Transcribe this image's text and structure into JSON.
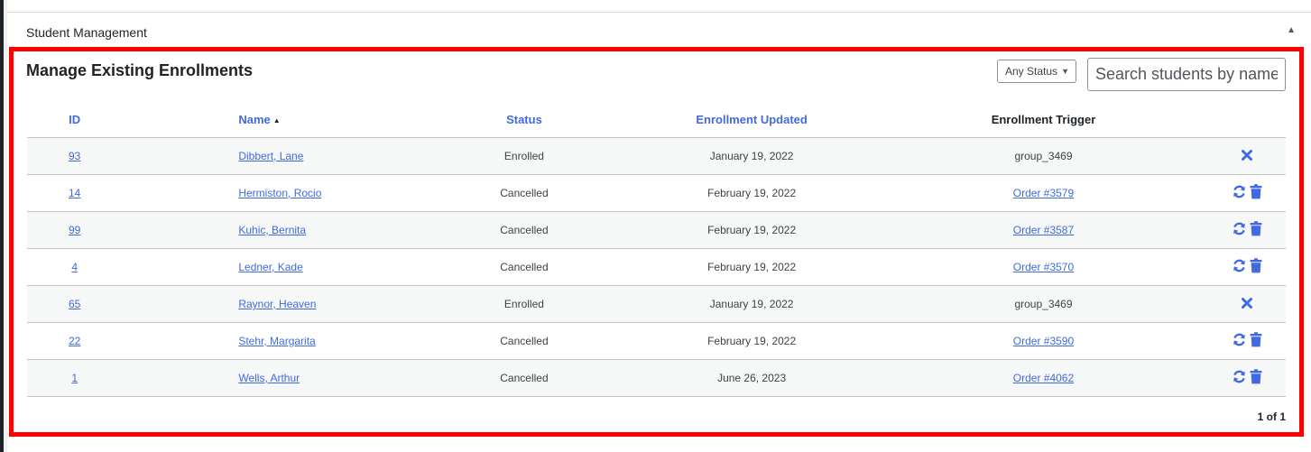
{
  "panel": {
    "title": "Student Management",
    "collapse_glyph": "▲"
  },
  "section": {
    "title": "Manage Existing Enrollments"
  },
  "filters": {
    "status_selected": "Any Status",
    "search_placeholder": "Search students by name"
  },
  "table": {
    "columns": {
      "id": "ID",
      "name": "Name",
      "name_sort_glyph": "▲",
      "status": "Status",
      "updated": "Enrollment Updated",
      "trigger": "Enrollment Trigger"
    },
    "rows": [
      {
        "id": "93",
        "name": "Dibbert, Lane",
        "status": "Enrolled",
        "updated": "January 19, 2022",
        "trigger": "group_3469",
        "trigger_is_link": false,
        "actions": [
          "remove-icon"
        ]
      },
      {
        "id": "14",
        "name": "Hermiston, Rocio",
        "status": "Cancelled",
        "updated": "February 19, 2022",
        "trigger": "Order #3579",
        "trigger_is_link": true,
        "actions": [
          "reactivate-icon",
          "trash-icon"
        ]
      },
      {
        "id": "99",
        "name": "Kuhic, Bernita",
        "status": "Cancelled",
        "updated": "February 19, 2022",
        "trigger": "Order #3587",
        "trigger_is_link": true,
        "actions": [
          "reactivate-icon",
          "trash-icon"
        ]
      },
      {
        "id": "4",
        "name": "Ledner, Kade",
        "status": "Cancelled",
        "updated": "February 19, 2022",
        "trigger": "Order #3570",
        "trigger_is_link": true,
        "actions": [
          "reactivate-icon",
          "trash-icon"
        ]
      },
      {
        "id": "65",
        "name": "Raynor, Heaven",
        "status": "Enrolled",
        "updated": "January 19, 2022",
        "trigger": "group_3469",
        "trigger_is_link": false,
        "actions": [
          "remove-icon"
        ]
      },
      {
        "id": "22",
        "name": "Stehr, Margarita",
        "status": "Cancelled",
        "updated": "February 19, 2022",
        "trigger": "Order #3590",
        "trigger_is_link": true,
        "actions": [
          "reactivate-icon",
          "trash-icon"
        ]
      },
      {
        "id": "1",
        "name": "Wells, Arthur",
        "status": "Cancelled",
        "updated": "June 26, 2023",
        "trigger": "Order #4062",
        "trigger_is_link": true,
        "actions": [
          "reactivate-icon",
          "trash-icon"
        ]
      }
    ]
  },
  "pagination": {
    "label": "1 of 1"
  },
  "colors": {
    "accent": "#4169e1",
    "highlight_frame": "#ff0000"
  }
}
